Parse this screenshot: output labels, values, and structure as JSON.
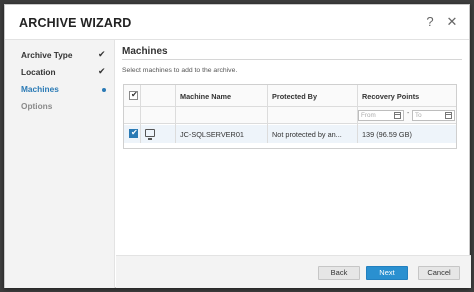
{
  "dialog": {
    "title": "ARCHIVE WIZARD",
    "help_glyph": "?",
    "close_glyph": "✕"
  },
  "sidebar": {
    "steps": [
      {
        "label": "Archive Type",
        "state": "complete",
        "mark": "✔"
      },
      {
        "label": "Location",
        "state": "complete",
        "mark": "✔"
      },
      {
        "label": "Machines",
        "state": "active",
        "mark": "●"
      },
      {
        "label": "Options",
        "state": "disabled",
        "mark": ""
      }
    ]
  },
  "main": {
    "section_title": "Machines",
    "instructions": "Select machines to add to the archive.",
    "grid": {
      "columns": [
        "Machine Name",
        "Protected By",
        "Recovery Points"
      ],
      "filters": {
        "from_placeholder": "From",
        "to_placeholder": "To",
        "separator": "-"
      },
      "rows": [
        {
          "selected": true,
          "icon": "monitor-icon",
          "machine_name": "JC-SQLSERVER01",
          "protected_by": "Not protected by an...",
          "recovery_points": "139 (96.59 GB)"
        }
      ]
    }
  },
  "footer": {
    "back_label": "Back",
    "next_label": "Next",
    "cancel_label": "Cancel"
  },
  "colors": {
    "accent": "#2a7ab5",
    "primary_button": "#2a90d0",
    "selected_row": "#eef4fa"
  }
}
